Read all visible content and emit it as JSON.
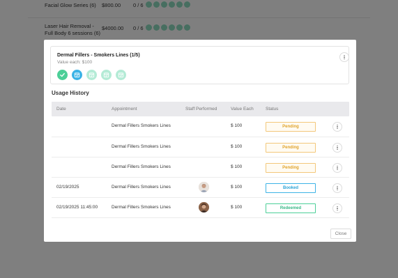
{
  "background": {
    "rows": [
      {
        "name": "Facial Glow Series (6)",
        "price": "$800.00",
        "count": "0 / 6"
      },
      {
        "name_line1": "Laser Hair Removal -",
        "name_line2": "Full Body 6 sessions (6)",
        "price": "$4000.00",
        "count": "0 / 6"
      }
    ]
  },
  "package": {
    "title": "Dermal Fillers - Smokers Lines (1/5)",
    "value_each": "Value each: $100",
    "icons": [
      {
        "state": "used",
        "icon": "check-icon"
      },
      {
        "state": "booked",
        "icon": "calendar-icon"
      },
      {
        "state": "available",
        "icon": "calendar-icon"
      },
      {
        "state": "available",
        "icon": "calendar-icon"
      },
      {
        "state": "available",
        "icon": "calendar-icon"
      }
    ]
  },
  "usage_history": {
    "title": "Usage History",
    "columns": [
      "Date",
      "Appointment",
      "Staff Performed",
      "Value Each",
      "Status"
    ],
    "rows": [
      {
        "date": "",
        "appointment": "Dermal Fillers Smokers Lines",
        "staff": "",
        "value": "$ 100",
        "status": "Pending"
      },
      {
        "date": "",
        "appointment": "Dermal Fillers Smokers Lines",
        "staff": "",
        "value": "$ 100",
        "status": "Pending"
      },
      {
        "date": "",
        "appointment": "Dermal Fillers Smokers Lines",
        "staff": "",
        "value": "$ 100",
        "status": "Pending"
      },
      {
        "date": "02/19/2025",
        "appointment": "Dermal Fillers Smokers Lines",
        "staff": "avatar",
        "value": "$ 100",
        "status": "Booked"
      },
      {
        "date": "02/19/2025 11:45:00",
        "appointment": "Dermal Fillers Smokers Lines",
        "staff": "avatar",
        "value": "$ 100",
        "status": "Redeemed"
      }
    ]
  },
  "close_label": "Close",
  "colors": {
    "used": "#4ccf98",
    "booked": "#3cb3e6",
    "available": "#b4ebd6",
    "pending": "#e0a42e",
    "overlay": "rgba(0,0,0,0.5)"
  }
}
